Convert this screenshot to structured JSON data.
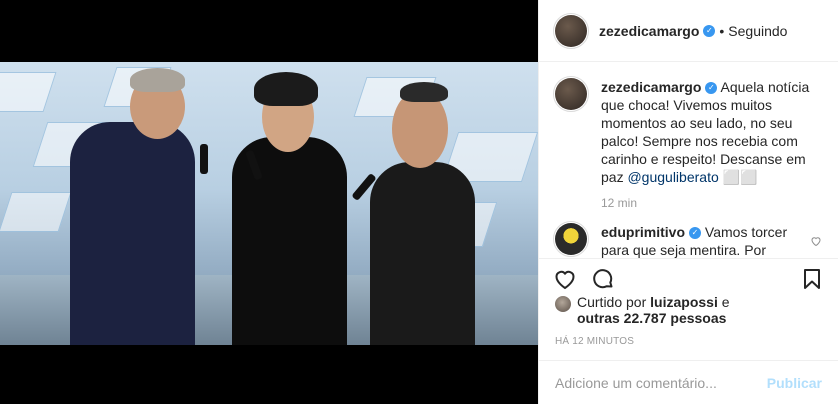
{
  "post": {
    "author": "zezedicamargo",
    "follow_status": "Seguindo",
    "separator": "•"
  },
  "caption": {
    "author": "zezedicamargo",
    "text": "Aquela notícia que choca! Vivemos muitos momentos ao seu lado, no seu palco! Sempre nos recebia com carinho e respeito! Descanse em paz ",
    "mention": "@guguliberato",
    "emoji": " ⬜⬜",
    "time": "12 min"
  },
  "comments": [
    {
      "author": "eduprimitivo",
      "text": "Vamos torcer para que seja mentira. Por enquanto nenhuma fonte segura"
    }
  ],
  "likes": {
    "prefix": "Curtido por ",
    "user": "luizapossi",
    "suffix": " e",
    "others": "outras 22.787 pessoas"
  },
  "timestamp": "HÁ 12 MINUTOS",
  "add_comment": {
    "placeholder": "Adicione um comentário...",
    "post_label": "Publicar"
  },
  "icons": {
    "verified": "verified-badge-icon",
    "like": "heart-icon",
    "comment": "comment-bubble-icon",
    "save": "bookmark-icon"
  },
  "colors": {
    "verified": "#3897f0",
    "link": "#003569",
    "muted": "#999999",
    "publish_disabled": "#b2dffc"
  }
}
